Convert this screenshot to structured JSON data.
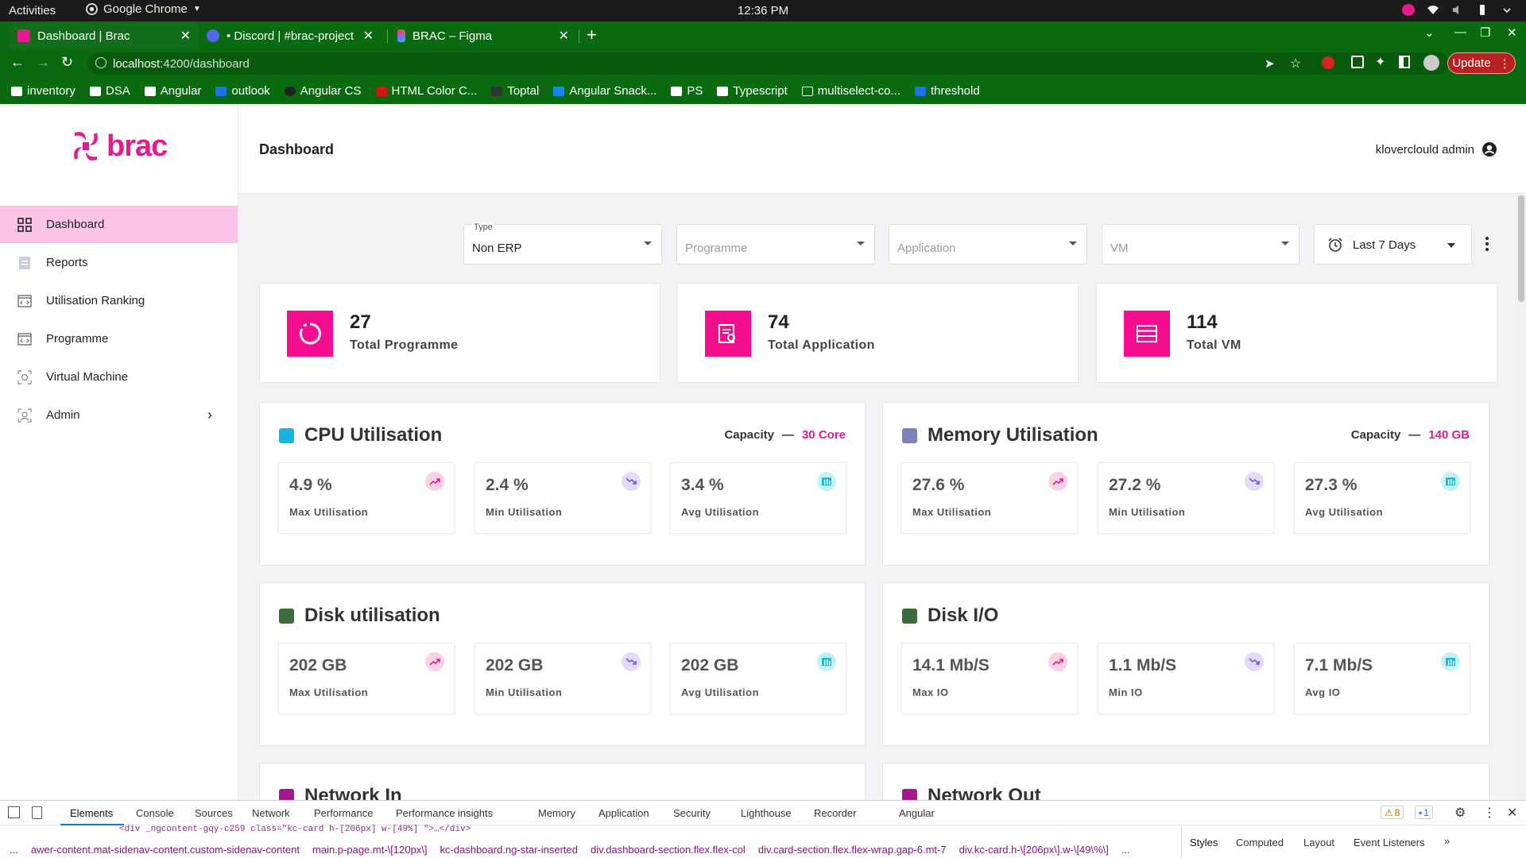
{
  "os_bar": {
    "activities": "Activities",
    "app_name": "Google Chrome",
    "clock": "12:36 PM"
  },
  "browser": {
    "tabs": [
      {
        "title": "Dashboard | Brac",
        "active": true
      },
      {
        "title": "• Discord | #brac-project |",
        "active": false
      },
      {
        "title": "BRAC – Figma",
        "active": false
      }
    ],
    "url_host": "localhost",
    "url_path": ":4200/dashboard",
    "update_label": "Update",
    "bookmarks": [
      "inventory",
      "DSA",
      "Angular",
      "outlook",
      "Angular CS",
      "HTML Color C...",
      "Toptal",
      "Angular Snack...",
      "PS",
      "Typescript",
      "multiselect-co...",
      "threshold"
    ]
  },
  "sidebar": {
    "logo_text": "brac",
    "items": [
      {
        "label": "Dashboard",
        "icon": "grid-icon"
      },
      {
        "label": "Reports",
        "icon": "report-icon"
      },
      {
        "label": "Utilisation Ranking",
        "icon": "code-window-icon"
      },
      {
        "label": "Programme",
        "icon": "code-window-icon"
      },
      {
        "label": "Virtual Machine",
        "icon": "vm-icon"
      },
      {
        "label": "Admin",
        "icon": "admin-icon"
      }
    ]
  },
  "header": {
    "title": "Dashboard",
    "user": "kloverclould admin"
  },
  "filters": {
    "type_label": "Type",
    "type_value": "Non ERP",
    "programme_placeholder": "Programme",
    "application_placeholder": "Application",
    "vm_placeholder": "VM",
    "date_range": "Last 7 Days"
  },
  "stats": [
    {
      "value": "27",
      "label": "Total Programme",
      "icon": "circle-icon"
    },
    {
      "value": "74",
      "label": "Total Application",
      "icon": "certificate-icon"
    },
    {
      "value": "114",
      "label": "Total VM",
      "icon": "server-icon"
    }
  ],
  "cpu": {
    "title": "CPU Utilisation",
    "capacity_label": "Capacity",
    "capacity_sep": "—",
    "capacity_value": "30 Core",
    "metrics": [
      {
        "value": "4.9 %",
        "label": "Max Utilisation"
      },
      {
        "value": "2.4 %",
        "label": "Min Utilisation"
      },
      {
        "value": "3.4 %",
        "label": "Avg Utilisation"
      }
    ]
  },
  "memory": {
    "title": "Memory Utilisation",
    "capacity_label": "Capacity",
    "capacity_sep": "—",
    "capacity_value": "140 GB",
    "metrics": [
      {
        "value": "27.6 %",
        "label": "Max Utilisation"
      },
      {
        "value": "27.2 %",
        "label": "Min Utilisation"
      },
      {
        "value": "27.3 %",
        "label": "Avg Utilisation"
      }
    ]
  },
  "disk": {
    "title": "Disk utilisation",
    "metrics": [
      {
        "value": "202 GB",
        "label": "Max Utilisation"
      },
      {
        "value": "202 GB",
        "label": "Min Utilisation"
      },
      {
        "value": "202 GB",
        "label": "Avg Utilisation"
      }
    ]
  },
  "disk_io": {
    "title": "Disk I/O",
    "metrics": [
      {
        "value": "14.1 Mb/S",
        "label": "Max IO"
      },
      {
        "value": "1.1 Mb/S",
        "label": "Min IO"
      },
      {
        "value": "7.1 Mb/S",
        "label": "Avg IO"
      }
    ]
  },
  "network_in": {
    "title": "Network In"
  },
  "network_out": {
    "title": "Network Out"
  },
  "devtools": {
    "tabs": [
      "Elements",
      "Console",
      "Sources",
      "Network",
      "Performance",
      "Performance insights",
      "Memory",
      "Application",
      "Security",
      "Lighthouse",
      "Recorder",
      "Angular"
    ],
    "warnings": "8",
    "messages": "1",
    "code_line": "<div _ngcontent-gqy-c259 class=\"kc-card h-[206px] w-[49%] \">…</div>",
    "breadcrumbs": [
      "...",
      "awer-content.mat-sidenav-content.custom-sidenav-content",
      "main.p-page.mt-\\[120px\\]",
      "kc-dashboard.ng-star-inserted",
      "div.dashboard-section.flex.flex-col",
      "div.card-section.flex.flex-wrap.gap-6.mt-7",
      "div.kc-card.h-\\[206px\\].w-\\[49\\%\\]",
      "..."
    ],
    "right_tabs": [
      "Styles",
      "Computed",
      "Layout",
      "Event Listeners"
    ]
  },
  "colors": {
    "brand": "#e8198b",
    "accent_icon": "#f50c8f",
    "browser_green": "#0a6a10",
    "active_nav": "#fbc4e7"
  }
}
